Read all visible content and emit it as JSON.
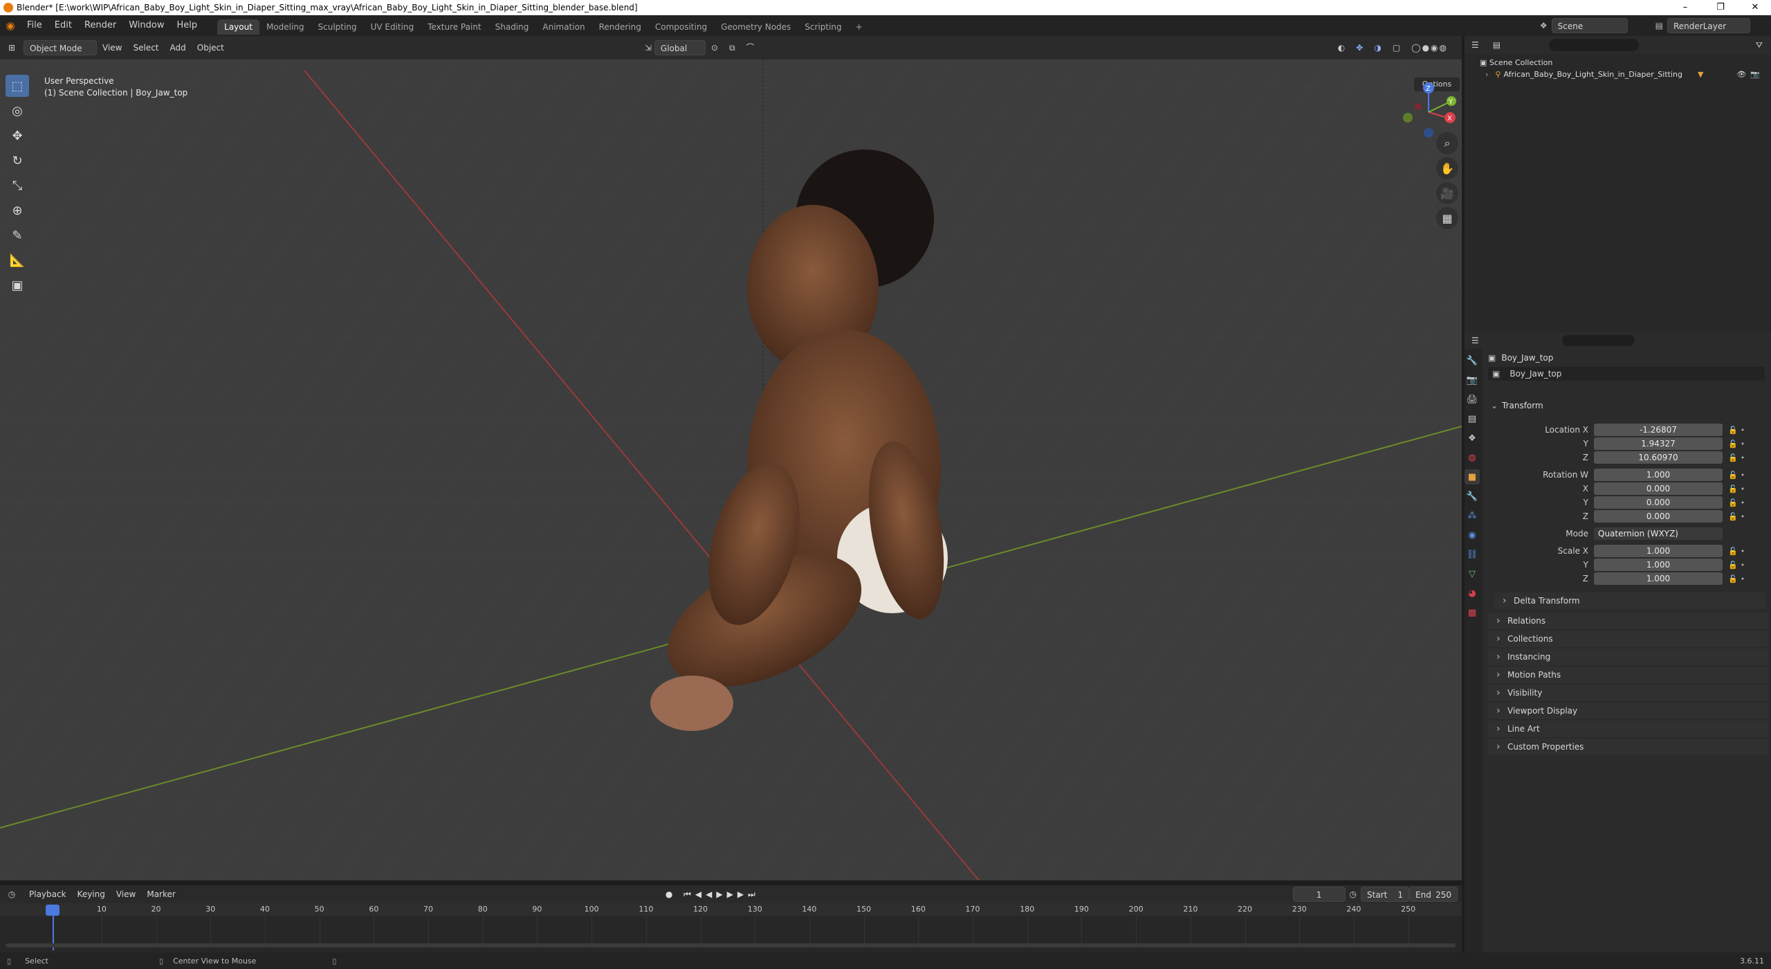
{
  "window": {
    "title": "Blender* [E:\\work\\WIP\\African_Baby_Boy_Light_Skin_in_Diaper_Sitting_max_vray\\African_Baby_Boy_Light_Skin_in_Diaper_Sitting_blender_base.blend]",
    "minimize": "–",
    "restore": "❐",
    "close": "✕"
  },
  "menu": [
    "File",
    "Edit",
    "Render",
    "Window",
    "Help"
  ],
  "workspaces": [
    "Layout",
    "Modeling",
    "Sculpting",
    "UV Editing",
    "Texture Paint",
    "Shading",
    "Animation",
    "Rendering",
    "Compositing",
    "Geometry Nodes",
    "Scripting"
  ],
  "workspace_add": "+",
  "scene": {
    "label": "Scene",
    "view_layer": "RenderLayer"
  },
  "viewport_header": {
    "mode": "Object Mode",
    "menus": [
      "View",
      "Select",
      "Add",
      "Object"
    ],
    "orientation": "Global",
    "options": "Options"
  },
  "viewport": {
    "perspective": "User Perspective",
    "collection_info": "(1) Scene Collection | Boy_Jaw_top",
    "gizmo_axes": [
      "X",
      "Y",
      "Z"
    ]
  },
  "outliner": {
    "root": "Scene Collection",
    "items": [
      {
        "label": "African_Baby_Boy_Light_Skin_in_Diaper_Sitting"
      }
    ]
  },
  "properties": {
    "object_name": "Boy_Jaw_top",
    "data_name": "Boy_Jaw_top",
    "transform_label": "Transform",
    "location": {
      "label": "Location X",
      "x": "-1.26807",
      "y_label": "Y",
      "y": "1.94327",
      "z_label": "Z",
      "z": "10.60970"
    },
    "rotation": {
      "label": "Rotation W",
      "w": "1.000",
      "x_label": "X",
      "x": "0.000",
      "y_label": "Y",
      "y": "0.000",
      "z_label": "Z",
      "z": "0.000"
    },
    "mode": {
      "label": "Mode",
      "value": "Quaternion (WXYZ)"
    },
    "scale": {
      "label": "Scale X",
      "x": "1.000",
      "y_label": "Y",
      "y": "1.000",
      "z_label": "Z",
      "z": "1.000"
    },
    "delta_transform": "Delta Transform",
    "panels": [
      "Relations",
      "Collections",
      "Instancing",
      "Motion Paths",
      "Visibility",
      "Viewport Display",
      "Line Art",
      "Custom Properties"
    ]
  },
  "timeline": {
    "menus": [
      "Playback",
      "Keying",
      "View",
      "Marker"
    ],
    "current_frame": "1",
    "start_label": "Start",
    "start": "1",
    "end_label": "End",
    "end": "250",
    "ticks": [
      "1",
      "10",
      "20",
      "30",
      "40",
      "50",
      "60",
      "70",
      "80",
      "90",
      "100",
      "110",
      "120",
      "130",
      "140",
      "150",
      "160",
      "170",
      "180",
      "190",
      "200",
      "210",
      "220",
      "230",
      "240",
      "250"
    ]
  },
  "statusbar": {
    "left": "Select",
    "middle": "Center View to Mouse",
    "version": "3.6.11"
  }
}
